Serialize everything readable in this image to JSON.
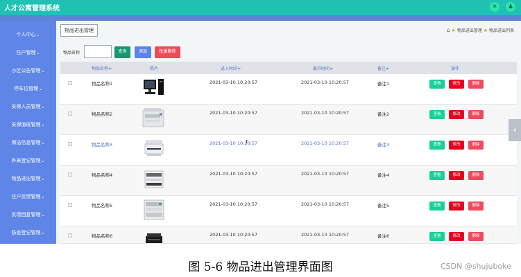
{
  "app": {
    "title": "人才公寓管理系统"
  },
  "top_icons": [
    "close-circle-icon",
    "user-circle-icon"
  ],
  "sidebar": {
    "items": [
      {
        "label": "个人中心",
        "has_arrow": true
      },
      {
        "label": "住户管理",
        "has_arrow": true
      },
      {
        "label": "小区公告管理",
        "has_arrow": true
      },
      {
        "label": "停车位管理",
        "has_arrow": true
      },
      {
        "label": "安保人员管理",
        "has_arrow": true
      },
      {
        "label": "安保值班管理",
        "has_arrow": true
      },
      {
        "label": "保洁信息管理",
        "has_arrow": true
      },
      {
        "label": "外来登记管理",
        "has_arrow": true
      },
      {
        "label": "物品进出管理",
        "has_arrow": true
      },
      {
        "label": "住户反馈管理",
        "has_arrow": true
      },
      {
        "label": "反馈回复管理",
        "has_arrow": true
      },
      {
        "label": "防疫登记管理",
        "has_arrow": true
      }
    ]
  },
  "tab": {
    "label": "物品进出管理"
  },
  "breadcrumb": {
    "current": "物品进出管理",
    "page": "物品进出列表"
  },
  "search": {
    "label": "物品名称",
    "value": "",
    "placeholder": "",
    "query_label": "查询",
    "add_label": "添加",
    "batch_delete_label": "批量删除"
  },
  "table": {
    "columns": [
      "物品名称≑",
      "照片",
      "进入时间≑",
      "离开时间≑",
      "备注≑",
      "操作"
    ],
    "actions": {
      "view": "查看",
      "edit": "修改",
      "delete": "删除"
    },
    "rows": [
      {
        "name": "物品名称1",
        "photo": "desktop-computer-image",
        "in_time": "2021-03-10 10:20:57",
        "out_time": "2021-03-10 10:20:57",
        "note": "备注1"
      },
      {
        "name": "物品名称2",
        "photo": "copier-image",
        "in_time": "2021-03-10 10:20:57",
        "out_time": "2021-03-10 10:20:57",
        "note": "备注2"
      },
      {
        "name": "物品名称3",
        "photo": "scanner-image",
        "in_time": "2021-03-10 10:20:57",
        "out_time": "2021-03-10 10:20:57",
        "note": "备注3",
        "highlight": true
      },
      {
        "name": "物品名称4",
        "photo": "printer-image",
        "in_time": "2021-03-10 10:20:57",
        "out_time": "2021-03-10 10:20:57",
        "note": "备注4"
      },
      {
        "name": "物品名称5",
        "photo": "large-copier-image",
        "in_time": "2021-03-10 10:20:57",
        "out_time": "2021-03-10 10:20:57",
        "note": "备注5"
      },
      {
        "name": "物品名称6",
        "photo": "printer-black-image",
        "in_time": "2021-03-10 10:20:57",
        "out_time": "2021-03-10 10:20:57",
        "note": "备注6"
      }
    ]
  },
  "caption": "图 5-6 物品进出管理界面图",
  "watermark": "CSDN @shujuboke",
  "colors": {
    "topbar": "#1fc1b3",
    "sidebar": "#5f86e6",
    "query_button": "#149870",
    "add_button": "#5b84e8",
    "batch_delete_button": "#ea4c5a",
    "view_button": "#19cf9a",
    "edit_button": "#e6001f",
    "delete_button": "#ef4b5f"
  }
}
